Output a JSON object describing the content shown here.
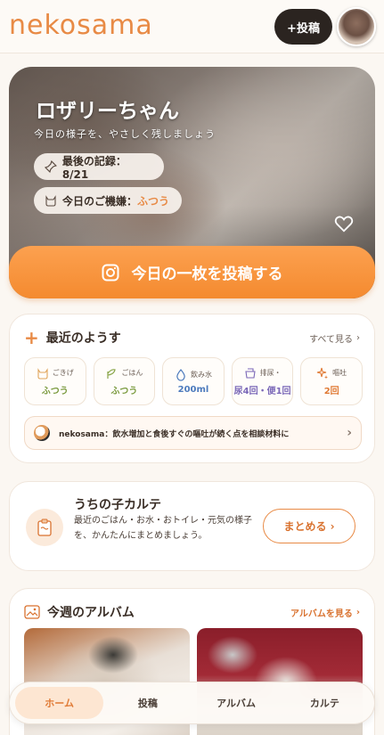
{
  "header": {
    "logo": "nekosama",
    "post_button": "+投稿"
  },
  "hero": {
    "pet_name": "ロザリーちゃん",
    "subtitle": "今日の様子を、やさしく残しましょう",
    "last_record_label": "最後の記録：8/21",
    "mood_label": "今日のご機嫌：",
    "mood_value": "ふつう",
    "cta_label": "今日の一枚を投稿する"
  },
  "recent": {
    "title": "最近のようす",
    "see_all": "すべて見る",
    "stats": [
      {
        "label": "ごきげ",
        "value": "ふつう",
        "icon": "cat-face-icon",
        "color": "#7a9a3e"
      },
      {
        "label": "ごはん",
        "value": "ふつう",
        "icon": "leaf-icon",
        "color": "#7a9a3e"
      },
      {
        "label": "飲み水",
        "value": "200ml",
        "icon": "water-drop-icon",
        "color": "#4d7bbd"
      },
      {
        "label": "排尿・",
        "value": "尿4回・便1回",
        "icon": "litter-box-icon",
        "color": "#7b68b8"
      },
      {
        "label": "嘔吐",
        "value": "2回",
        "icon": "sparkle-icon",
        "color": "#e07a35"
      }
    ],
    "note": "nekosama：飲水増加と食後すぐの嘔吐が続く点を相談材料に"
  },
  "karte": {
    "title": "うちの子カルテ",
    "description": "最近のごはん・お水・おトイレ・元気の様子を、かんたんにまとめましょう。",
    "button": "まとめる ›"
  },
  "album": {
    "title": "今週のアルバム",
    "link": "アルバムを見る"
  },
  "nav": {
    "home": "ホーム",
    "post": "投稿",
    "album": "アルバム",
    "karte": "カルテ"
  },
  "colors": {
    "accent": "#e88a45",
    "cta": "#f48a2f",
    "dark_button": "#2b2420"
  }
}
